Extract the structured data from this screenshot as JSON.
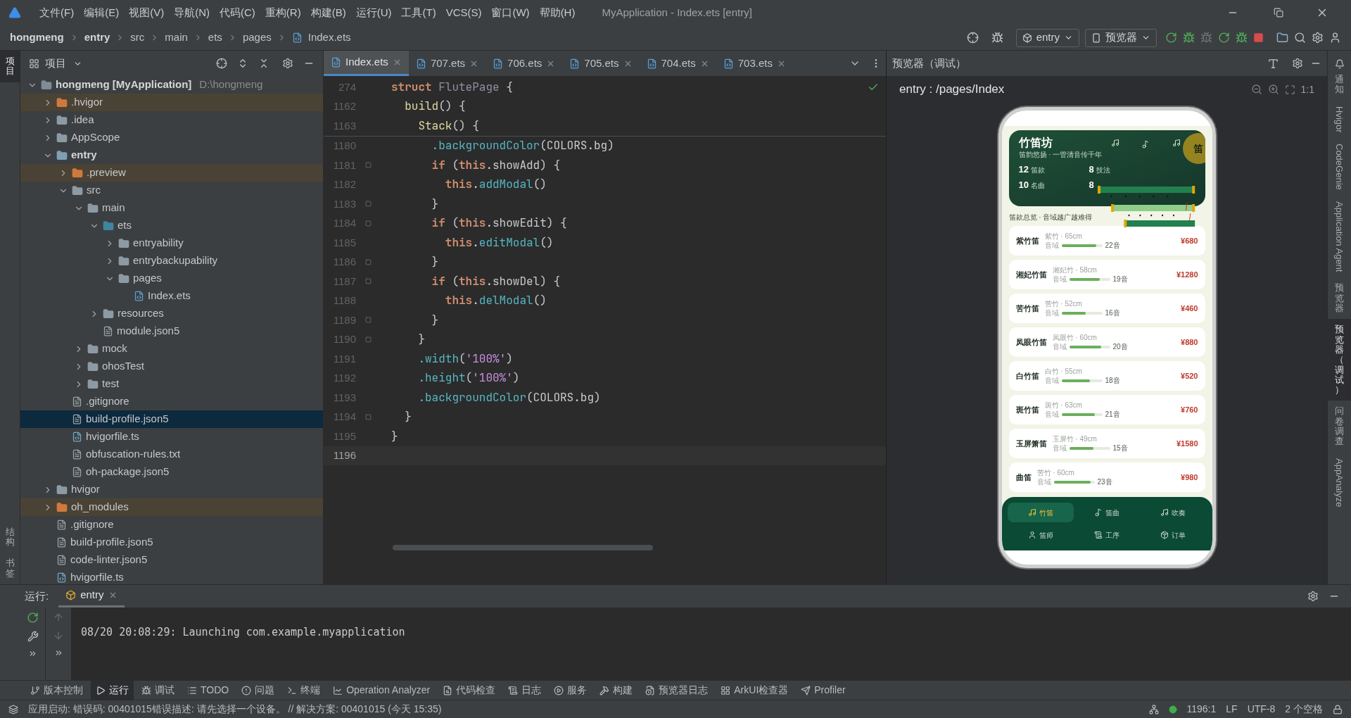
{
  "menu_bar": {
    "items": [
      "文件(F)",
      "编辑(E)",
      "视图(V)",
      "导航(N)",
      "代码(C)",
      "重构(R)",
      "构建(B)",
      "运行(U)",
      "工具(T)",
      "VCS(S)",
      "窗口(W)",
      "帮助(H)"
    ],
    "title": "MyApplication - Index.ets [entry]"
  },
  "nav_bar": {
    "breadcrumbs": [
      {
        "label": "hongmeng",
        "bold": true
      },
      {
        "label": "entry",
        "bold": true
      },
      {
        "label": "src",
        "bold": false
      },
      {
        "label": "main",
        "bold": false
      },
      {
        "label": "ets",
        "bold": false
      },
      {
        "label": "pages",
        "bold": false
      },
      {
        "label": "Index.ets",
        "bold": false
      }
    ],
    "run_config": "entry",
    "device": "预览器"
  },
  "left_strip": {
    "top": [
      {
        "label": "项目",
        "selected": true
      }
    ],
    "bottom": [
      {
        "label": "结构",
        "selected": false
      },
      {
        "label": "书签",
        "selected": false
      }
    ]
  },
  "project_panel": {
    "title": "项目",
    "tree": [
      {
        "name": "hongmeng [MyApplication]",
        "path": "D:\\hongmeng",
        "kind": "project",
        "expanded": true,
        "selected": false,
        "children": [
          {
            "name": ".hvigor",
            "kind": "excluded-folder",
            "expanded": false,
            "selected": false
          },
          {
            "name": ".idea",
            "kind": "folder",
            "expanded": false,
            "selected": false
          },
          {
            "name": "AppScope",
            "kind": "folder",
            "expanded": false,
            "selected": false
          },
          {
            "name": "entry",
            "kind": "module",
            "expanded": true,
            "selected": false,
            "children": [
              {
                "name": ".preview",
                "kind": "excluded-folder",
                "expanded": false,
                "selected": false
              },
              {
                "name": "src",
                "kind": "folder",
                "expanded": true,
                "selected": false,
                "children": [
                  {
                    "name": "main",
                    "kind": "folder",
                    "expanded": true,
                    "selected": false,
                    "children": [
                      {
                        "name": "ets",
                        "kind": "source-folder",
                        "expanded": true,
                        "selected": false,
                        "children": [
                          {
                            "name": "entryability",
                            "kind": "folder",
                            "expanded": false,
                            "selected": false
                          },
                          {
                            "name": "entrybackupability",
                            "kind": "folder",
                            "expanded": false,
                            "selected": false
                          },
                          {
                            "name": "pages",
                            "kind": "folder",
                            "expanded": true,
                            "selected": false,
                            "children": [
                              {
                                "name": "Index.ets",
                                "kind": "ets-file",
                                "selected": false
                              }
                            ]
                          }
                        ]
                      },
                      {
                        "name": "resources",
                        "kind": "folder",
                        "expanded": false,
                        "selected": false
                      },
                      {
                        "name": "module.json5",
                        "kind": "file",
                        "selected": false
                      }
                    ]
                  },
                  {
                    "name": "mock",
                    "kind": "folder",
                    "expanded": false,
                    "selected": false
                  },
                  {
                    "name": "ohosTest",
                    "kind": "folder",
                    "expanded": false,
                    "selected": false
                  },
                  {
                    "name": "test",
                    "kind": "folder",
                    "expanded": false,
                    "selected": false
                  }
                ]
              },
              {
                "name": ".gitignore",
                "kind": "file",
                "selected": false
              },
              {
                "name": "build-profile.json5",
                "kind": "file",
                "selected": true
              },
              {
                "name": "hvigorfile.ts",
                "kind": "ts-file",
                "selected": false
              },
              {
                "name": "obfuscation-rules.txt",
                "kind": "file",
                "selected": false
              },
              {
                "name": "oh-package.json5",
                "kind": "file",
                "selected": false
              }
            ]
          },
          {
            "name": "hvigor",
            "kind": "folder",
            "expanded": false,
            "selected": false
          },
          {
            "name": "oh_modules",
            "kind": "excluded-folder",
            "expanded": false,
            "selected": false
          },
          {
            "name": ".gitignore",
            "kind": "file",
            "selected": false
          },
          {
            "name": "build-profile.json5",
            "kind": "file",
            "selected": false
          },
          {
            "name": "code-linter.json5",
            "kind": "file",
            "selected": false
          },
          {
            "name": "hvigorfile.ts",
            "kind": "ts-file",
            "selected": false
          }
        ]
      }
    ]
  },
  "editor": {
    "tabs": [
      {
        "label": "Index.ets",
        "selected": true
      },
      {
        "label": "707.ets",
        "selected": false
      },
      {
        "label": "706.ets",
        "selected": false
      },
      {
        "label": "705.ets",
        "selected": false
      },
      {
        "label": "704.ets",
        "selected": false
      },
      {
        "label": "703.ets",
        "selected": false
      }
    ],
    "sticky_lines": [
      {
        "number": "274",
        "fold": false,
        "current": false,
        "tokens": [
          {
            "text": "struct ",
            "kind": "keyword"
          },
          {
            "text": "FlutePage",
            "kind": "type"
          },
          {
            "text": " {",
            "kind": "plain"
          }
        ]
      },
      {
        "number": "1162",
        "fold": false,
        "current": false,
        "tokens": [
          {
            "text": "  build",
            "kind": "fn"
          },
          {
            "text": "() {",
            "kind": "plain"
          }
        ]
      },
      {
        "number": "1163",
        "fold": false,
        "current": false,
        "tokens": [
          {
            "text": "    Stack",
            "kind": "fn"
          },
          {
            "text": "() {",
            "kind": "plain"
          }
        ]
      }
    ],
    "lines": [
      {
        "number": "1180",
        "fold": false,
        "current": false,
        "tokens": [
          {
            "text": "      .backgroundColor",
            "kind": "method"
          },
          {
            "text": "(COLORS.bg)",
            "kind": "plain"
          }
        ]
      },
      {
        "number": "1181",
        "fold": true,
        "current": false,
        "tokens": [
          {
            "text": "      if",
            "kind": "keyword"
          },
          {
            "text": " (",
            "kind": "plain"
          },
          {
            "text": "this",
            "kind": "keyword"
          },
          {
            "text": ".showAdd) {",
            "kind": "plain"
          }
        ]
      },
      {
        "number": "1182",
        "fold": false,
        "current": false,
        "tokens": [
          {
            "text": "        this",
            "kind": "keyword"
          },
          {
            "text": ".",
            "kind": "plain"
          },
          {
            "text": "addModal",
            "kind": "method"
          },
          {
            "text": "()",
            "kind": "plain"
          }
        ]
      },
      {
        "number": "1183",
        "fold": true,
        "current": false,
        "tokens": [
          {
            "text": "      }",
            "kind": "plain"
          }
        ]
      },
      {
        "number": "1184",
        "fold": true,
        "current": false,
        "tokens": [
          {
            "text": "      if",
            "kind": "keyword"
          },
          {
            "text": " (",
            "kind": "plain"
          },
          {
            "text": "this",
            "kind": "keyword"
          },
          {
            "text": ".showEdit) {",
            "kind": "plain"
          }
        ]
      },
      {
        "number": "1185",
        "fold": false,
        "current": false,
        "tokens": [
          {
            "text": "        this",
            "kind": "keyword"
          },
          {
            "text": ".",
            "kind": "plain"
          },
          {
            "text": "editModal",
            "kind": "method"
          },
          {
            "text": "()",
            "kind": "plain"
          }
        ]
      },
      {
        "number": "1186",
        "fold": true,
        "current": false,
        "tokens": [
          {
            "text": "      }",
            "kind": "plain"
          }
        ]
      },
      {
        "number": "1187",
        "fold": true,
        "current": false,
        "tokens": [
          {
            "text": "      if",
            "kind": "keyword"
          },
          {
            "text": " (",
            "kind": "plain"
          },
          {
            "text": "this",
            "kind": "keyword"
          },
          {
            "text": ".showDel) {",
            "kind": "plain"
          }
        ]
      },
      {
        "number": "1188",
        "fold": false,
        "current": false,
        "tokens": [
          {
            "text": "        this",
            "kind": "keyword"
          },
          {
            "text": ".",
            "kind": "plain"
          },
          {
            "text": "delModal",
            "kind": "method"
          },
          {
            "text": "()",
            "kind": "plain"
          }
        ]
      },
      {
        "number": "1189",
        "fold": true,
        "current": false,
        "tokens": [
          {
            "text": "      }",
            "kind": "plain"
          }
        ]
      },
      {
        "number": "1190",
        "fold": true,
        "current": false,
        "tokens": [
          {
            "text": "    }",
            "kind": "plain"
          }
        ]
      },
      {
        "number": "1191",
        "fold": false,
        "current": false,
        "tokens": [
          {
            "text": "    .width",
            "kind": "method"
          },
          {
            "text": "(",
            "kind": "plain"
          },
          {
            "text": "'100%'",
            "kind": "string"
          },
          {
            "text": ")",
            "kind": "plain"
          }
        ]
      },
      {
        "number": "1192",
        "fold": false,
        "current": false,
        "tokens": [
          {
            "text": "    .height",
            "kind": "method"
          },
          {
            "text": "(",
            "kind": "plain"
          },
          {
            "text": "'100%'",
            "kind": "string"
          },
          {
            "text": ")",
            "kind": "plain"
          }
        ]
      },
      {
        "number": "1193",
        "fold": false,
        "current": false,
        "tokens": [
          {
            "text": "    .backgroundColor",
            "kind": "method"
          },
          {
            "text": "(COLORS.bg)",
            "kind": "plain"
          }
        ]
      },
      {
        "number": "1194",
        "fold": true,
        "current": false,
        "tokens": [
          {
            "text": "  }",
            "kind": "plain"
          }
        ]
      },
      {
        "number": "1195",
        "fold": false,
        "current": false,
        "tokens": [
          {
            "text": "}",
            "kind": "plain"
          }
        ]
      },
      {
        "number": "1196",
        "fold": false,
        "current": true
      }
    ]
  },
  "preview": {
    "title": "预览器（调试）",
    "route": "entry : /pages/Index",
    "zoom_label": "1:1",
    "app": {
      "header": {
        "title": "竹笛坊",
        "subtitle": "笛韵悠扬 · 一管清音传千年",
        "badge": "笛",
        "stats": [
          {
            "value": "12",
            "label": "笛款"
          },
          {
            "value": "8",
            "label": "技法"
          },
          {
            "value": "10",
            "label": "名曲"
          },
          {
            "value": "8"
          }
        ]
      },
      "section_title": "笛款总览 · 音域越广越难得",
      "flutes": [
        {
          "name": "紫竹笛",
          "material": "紫竹 · 65cm",
          "range_label": "音域",
          "level": 0.85,
          "notes": "22音",
          "price": "¥680"
        },
        {
          "name": "湘妃竹笛",
          "material": "湘妃竹 · 58cm",
          "range_label": "音域",
          "level": 0.75,
          "notes": "19音",
          "price": "¥1280"
        },
        {
          "name": "苦竹笛",
          "material": "苦竹 · 52cm",
          "range_label": "音域",
          "level": 0.6,
          "notes": "16音",
          "price": "¥460"
        },
        {
          "name": "凤眼竹笛",
          "material": "凤眼竹 · 60cm",
          "range_label": "音域",
          "level": 0.78,
          "notes": "20音",
          "price": "¥880"
        },
        {
          "name": "白竹笛",
          "material": "白竹 · 55cm",
          "range_label": "音域",
          "level": 0.7,
          "notes": "18音",
          "price": "¥520"
        },
        {
          "name": "斑竹笛",
          "material": "斑竹 · 63cm",
          "range_label": "音域",
          "level": 0.82,
          "notes": "21音",
          "price": "¥760"
        },
        {
          "name": "玉屏箫笛",
          "material": "玉屏竹 · 49cm",
          "range_label": "音域",
          "level": 0.6,
          "notes": "15音",
          "price": "¥1580"
        },
        {
          "name": "曲笛",
          "material": "苦竹 · 60cm",
          "range_label": "音域",
          "level": 0.9,
          "notes": "23音",
          "price": "¥980"
        }
      ],
      "nav": [
        {
          "label": "竹笛",
          "selected": true
        },
        {
          "label": "笛曲",
          "selected": false
        },
        {
          "label": "吹奏",
          "selected": false
        },
        {
          "label": "笛师",
          "selected": false
        },
        {
          "label": "工序",
          "selected": false
        },
        {
          "label": "订单",
          "selected": false
        }
      ]
    }
  },
  "right_strip": [
    {
      "label": "通知",
      "kind": "stacked",
      "selected": false
    },
    {
      "label": "Hvigor",
      "kind": "rotated",
      "selected": false
    },
    {
      "label": "CodeGenie",
      "kind": "rotated",
      "selected": false
    },
    {
      "label": "Application Agent",
      "kind": "rotated",
      "selected": false
    },
    {
      "label": "预览器",
      "kind": "stacked",
      "selected": false
    },
    {
      "label": "预览器（调试）",
      "kind": "stacked",
      "selected": true
    },
    {
      "label": "问卷调查",
      "kind": "stacked",
      "selected": false
    },
    {
      "label": "AppAnalyze",
      "kind": "rotated",
      "selected": false
    }
  ],
  "run_panel": {
    "label": "运行:",
    "tabs": [
      {
        "label": "entry",
        "selected": true
      }
    ],
    "console": [
      "08/20 20:08:29: Launching com.example.myapplication"
    ]
  },
  "tool_bar": [
    {
      "label": "版本控制",
      "selected": false
    },
    {
      "label": "运行",
      "selected": true
    },
    {
      "label": "调试",
      "selected": false
    },
    {
      "label": "TODO",
      "selected": false
    },
    {
      "label": "问题",
      "selected": false
    },
    {
      "label": "终端",
      "selected": false
    },
    {
      "label": "Operation Analyzer",
      "selected": false
    },
    {
      "label": "代码检查",
      "selected": false
    },
    {
      "label": "日志",
      "selected": false
    },
    {
      "label": "服务",
      "selected": false
    },
    {
      "label": "构建",
      "selected": false
    },
    {
      "label": "预览器日志",
      "selected": false
    },
    {
      "label": "ArkUI检查器",
      "selected": false
    },
    {
      "label": "Profiler",
      "selected": false
    }
  ],
  "status_bar": {
    "message": "应用启动: 错误码: 00401015错误描述: 请先选择一个设备。 // 解决方案: 00401015 (今天 15:35)",
    "position": "1196:1",
    "line_ending": "LF",
    "encoding": "UTF-8",
    "indent": "2 个空格"
  }
}
